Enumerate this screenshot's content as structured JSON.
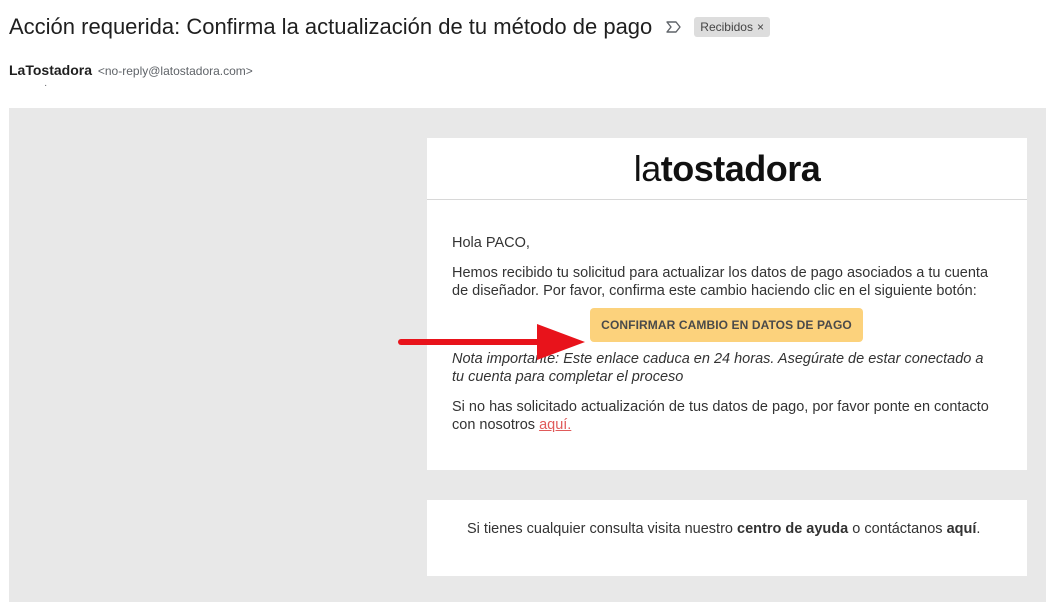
{
  "email": {
    "subject": "Acción requerida: Confirma la actualización de tu método de pago",
    "label": "Recibidos",
    "label_remove": "×",
    "sender_name": "LaTostadora",
    "sender_email": "<no-reply@latostadora.com>",
    "to_indicator": "·"
  },
  "message": {
    "logo_prefix": "la",
    "logo_main": "tostadora",
    "greeting": "Hola PACO,",
    "intro": "Hemos recibido tu solicitud para actualizar los datos de pago asociados a tu cuenta de diseñador. Por favor, confirma este cambio haciendo clic en el siguiente botón:",
    "cta_label": "CONFIRMAR CAMBIO EN DATOS DE PAGO",
    "note": "Nota importante: Este enlace caduca en 24 horas. Asegúrate de estar conectado a tu cuenta para completar el proceso",
    "contact_text": "Si no has solicitado actualización de tus datos de pago, por favor ponte en contacto con nosotros ",
    "contact_link": "aquí."
  },
  "footer": {
    "text_1": "Si tienes cualquier consulta visita nuestro ",
    "help_center": "centro de ayuda",
    "text_2": " o contáctanos ",
    "here": "aquí",
    "end": "."
  },
  "colors": {
    "cta_background": "#fcd27c",
    "link": "#e05a5a",
    "arrow": "#e8131b",
    "canvas": "#e8e8e8"
  },
  "icons": {
    "importance": "importance-marker-icon",
    "annotation": "red-arrow-icon"
  }
}
